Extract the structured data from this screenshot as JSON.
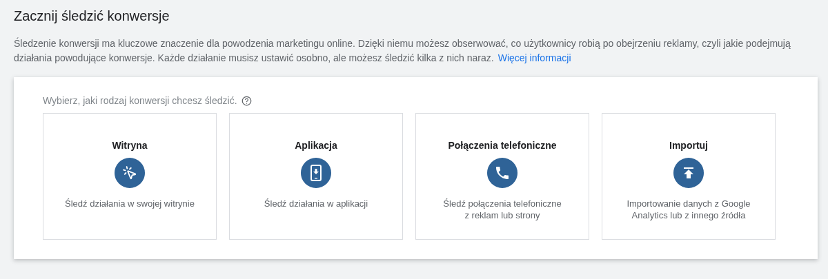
{
  "title": "Zacznij śledzić konwersje",
  "intro": {
    "text": "Śledzenie konwersji ma kluczowe znaczenie dla powodzenia marketingu online. Dzięki niemu możesz obserwować, co użytkownicy robią po obejrzeniu reklamy, czyli jakie podejmują działania powodujące konwersje. Każde działanie musisz ustawić osobno, ale możesz śledzić kilka z nich naraz.",
    "link": "Więcej informacji"
  },
  "prompt": "Wybierz, jaki rodzaj konwersji chcesz śledzić.",
  "options": [
    {
      "title": "Witryna",
      "description": [
        "Śledź działania w swojej witrynie"
      ]
    },
    {
      "title": "Aplikacja",
      "description": [
        "Śledź działania w aplikacji"
      ]
    },
    {
      "title": "Połączenia telefoniczne",
      "description": [
        "Śledź połączenia telefoniczne",
        "z reklam lub strony"
      ]
    },
    {
      "title": "Importuj",
      "description": [
        "Importowanie danych z Google",
        "Analytics lub z innego źródła"
      ]
    }
  ]
}
